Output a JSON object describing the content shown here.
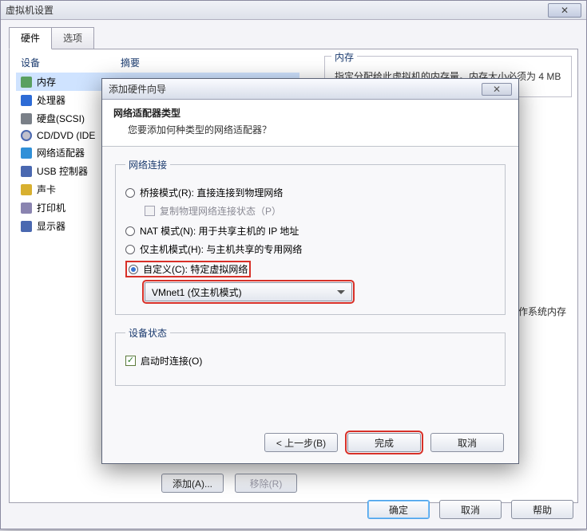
{
  "settingsWindow": {
    "title": "虚拟机设置",
    "tabs": {
      "hardware": "硬件",
      "options": "选项"
    },
    "columns": {
      "device": "设备",
      "summary": "摘要"
    },
    "devices": [
      {
        "icon": "ic-mem",
        "name": "内存"
      },
      {
        "icon": "ic-cpu",
        "name": "处理器"
      },
      {
        "icon": "ic-hdd",
        "name": "硬盘(SCSI)"
      },
      {
        "icon": "ic-cd",
        "name": "CD/DVD (IDE"
      },
      {
        "icon": "ic-net",
        "name": "网络适配器"
      },
      {
        "icon": "ic-usb",
        "name": "USB 控制器"
      },
      {
        "icon": "ic-snd",
        "name": "声卡"
      },
      {
        "icon": "ic-prn",
        "name": "打印机"
      },
      {
        "icon": "ic-disp",
        "name": "显示器"
      }
    ],
    "rightPanel": {
      "legend": "内存",
      "text": "指定分配给此虚拟机的内存量。内存大小必须为 4 MB"
    },
    "rightPanel2": {
      "text": "操作系统内存"
    },
    "bottom": {
      "add": "添加(A)...",
      "remove": "移除(R)"
    },
    "footer": {
      "ok": "确定",
      "cancel": "取消",
      "help": "帮助"
    }
  },
  "wizard": {
    "title": "添加硬件向导",
    "header": {
      "h1": "网络适配器类型",
      "h2": "您要添加何种类型的网络适配器？"
    },
    "connGroup": {
      "legend": "网络连接",
      "bridged": "桥接模式(R): 直接连接到物理网络",
      "replicate": "复制物理网络连接状态（P）",
      "nat": "NAT 模式(N): 用于共享主机的 IP 地址",
      "hostonly": "仅主机模式(H): 与主机共享的专用网络",
      "custom": "自定义(C): 特定虚拟网络",
      "comboValue": "VMnet1 (仅主机模式)"
    },
    "stateGroup": {
      "legend": "设备状态",
      "connectOnStart": "启动时连接(O)"
    },
    "footer": {
      "back": "< 上一步(B)",
      "finish": "完成",
      "cancel": "取消"
    }
  }
}
